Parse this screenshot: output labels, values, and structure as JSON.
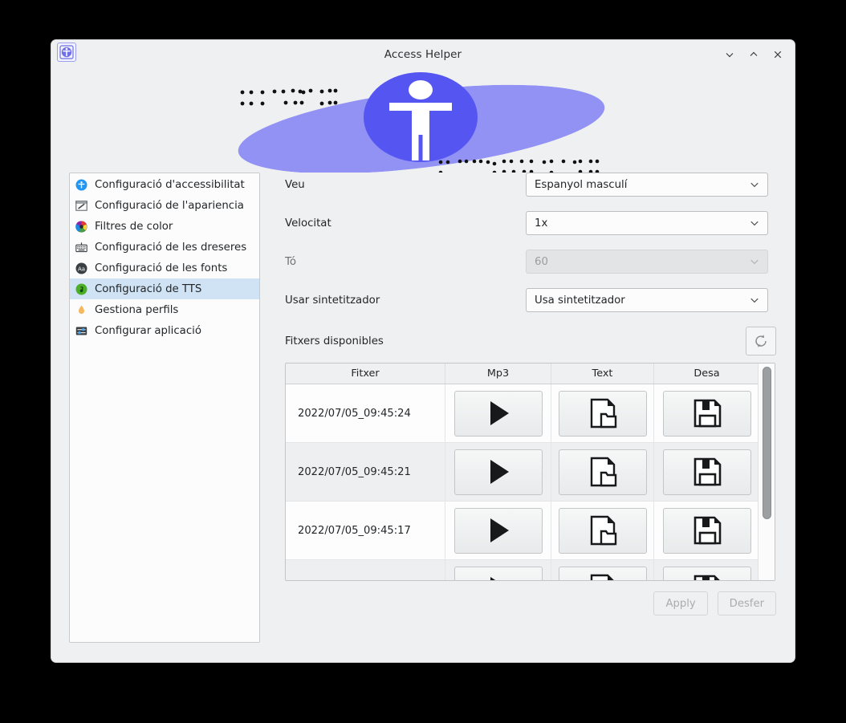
{
  "window": {
    "title": "Access Helper",
    "app_icon": "accessibility-app-icon",
    "controls": [
      {
        "name": "minimize-button",
        "glyph": "chevron-down-icon"
      },
      {
        "name": "maximize-button",
        "glyph": "chevron-up-icon"
      },
      {
        "name": "close-button",
        "glyph": "close-icon"
      }
    ]
  },
  "banner": {
    "lens_color": "#9292f5",
    "circle_color": "#5555f2",
    "figure_color": "#ffffff",
    "figure_icon": "accessibility-person-icon",
    "braille_left": "braille-decoration",
    "braille_right": "braille-decoration"
  },
  "sidebar": {
    "items": [
      {
        "label": "Configuració d'accessibilitat",
        "icon": "accessibility-icon",
        "selected": false
      },
      {
        "label": "Configuració de l'apariencia",
        "icon": "appearance-icon",
        "selected": false
      },
      {
        "label": "Filtres de color",
        "icon": "color-wheel-icon",
        "selected": false
      },
      {
        "label": "Configuració de les dreseres",
        "icon": "keyboard-icon",
        "selected": false
      },
      {
        "label": "Configuració de les fonts",
        "icon": "font-icon",
        "selected": false
      },
      {
        "label": "Configuració de TTS",
        "icon": "tts-icon",
        "selected": true
      },
      {
        "label": "Gestiona perfils",
        "icon": "profile-flame-icon",
        "selected": false
      },
      {
        "label": "Configurar aplicació",
        "icon": "sliders-icon",
        "selected": false
      }
    ],
    "selection_color": "#cfe3f5"
  },
  "form": {
    "rows": [
      {
        "label": "Veu",
        "value": "Espanyol masculí",
        "disabled": false
      },
      {
        "label": "Velocitat",
        "value": "1x",
        "disabled": false
      },
      {
        "label": "Tó",
        "value": "60",
        "disabled": true
      },
      {
        "label": "Usar sintetitzador",
        "value": "Usa sintetitzador",
        "disabled": false
      }
    ]
  },
  "files": {
    "label": "Fitxers disponibles",
    "refresh_icon": "refresh-icon",
    "columns": [
      "Fitxer",
      "Mp3",
      "Text",
      "Desa"
    ],
    "rows": [
      {
        "name": "2022/07/05_09:45:24",
        "mp3_icon": "play-icon",
        "text_icon": "document-folder-icon",
        "save_icon": "floppy-save-icon"
      },
      {
        "name": "2022/07/05_09:45:21",
        "mp3_icon": "play-icon",
        "text_icon": "document-folder-icon",
        "save_icon": "floppy-save-icon"
      },
      {
        "name": "2022/07/05_09:45:17",
        "mp3_icon": "play-icon",
        "text_icon": "document-folder-icon",
        "save_icon": "floppy-save-icon"
      },
      {
        "name": "",
        "mp3_icon": "play-icon",
        "text_icon": "document-folder-icon",
        "save_icon": "floppy-save-icon"
      }
    ]
  },
  "footer": {
    "apply_label": "Apply",
    "undo_label": "Desfer"
  }
}
